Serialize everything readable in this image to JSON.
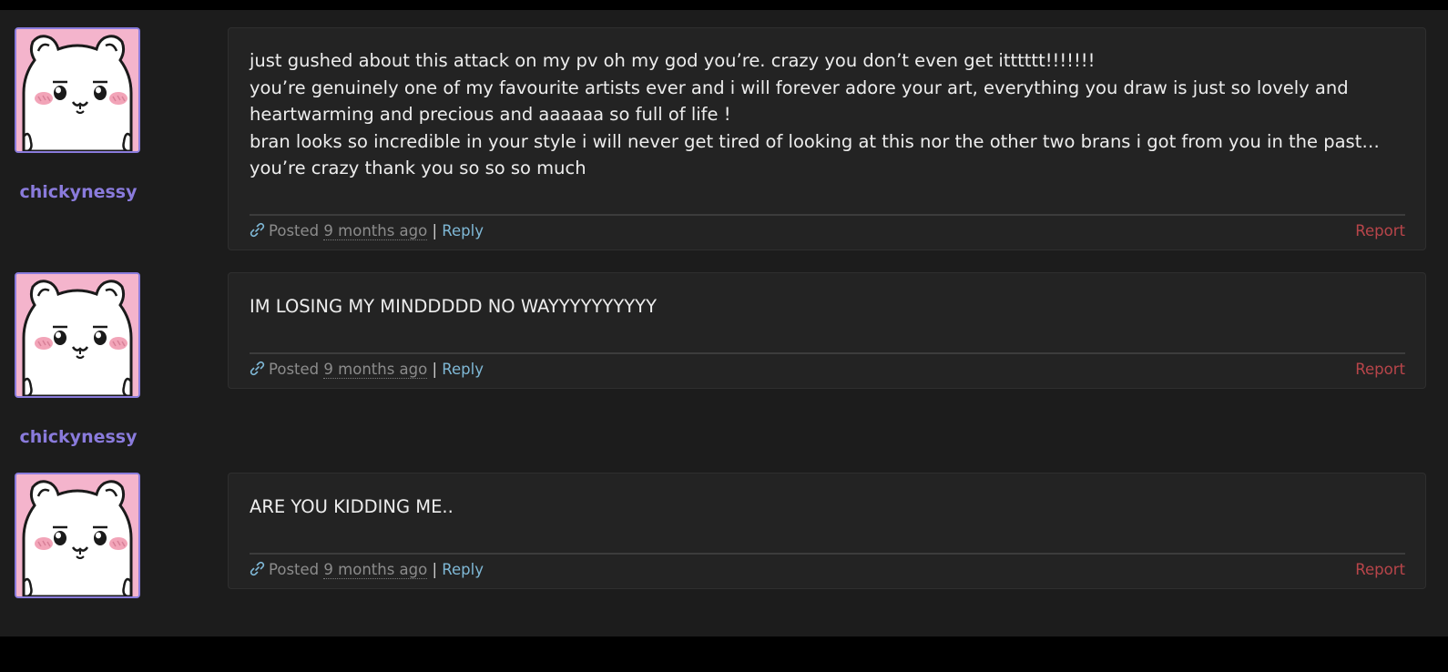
{
  "comments": [
    {
      "username": "chickynessy",
      "avatar_icon": "chiikawa-avatar-icon",
      "lines": [
        "just gushed about this attack on my pv oh my god you’re. crazy you don’t even get itttttt!!!!!!!",
        "you’re genuinely one of my favourite artists ever and i will forever adore your art, everything you draw is just so lovely and heartwarming and precious and aaaaaa so full of life !",
        "bran looks so incredible in your style i will never get tired of looking at this nor the other two brans i got from you in the past…you’re crazy thank you so so so much"
      ],
      "posted_label": "Posted",
      "time": "9 months ago",
      "separator": "|",
      "reply_label": "Reply",
      "report_label": "Report"
    },
    {
      "username": "chickynessy",
      "avatar_icon": "chiikawa-avatar-icon",
      "lines": [
        "IM LOSING MY MINDDDDD NO WAYYYYYYYYYY"
      ],
      "posted_label": "Posted",
      "time": "9 months ago",
      "separator": "|",
      "reply_label": "Reply",
      "report_label": "Report"
    },
    {
      "username": "",
      "avatar_icon": "chiikawa-avatar-icon",
      "lines": [
        "ARE YOU KIDDING ME.."
      ],
      "posted_label": "Posted",
      "time": "9 months ago",
      "separator": "|",
      "reply_label": "Reply",
      "report_label": "Report"
    }
  ],
  "colors": {
    "username": "#8a7bdc",
    "reply": "#7fb8d6",
    "report": "#b8454a",
    "card_bg": "#232323"
  }
}
